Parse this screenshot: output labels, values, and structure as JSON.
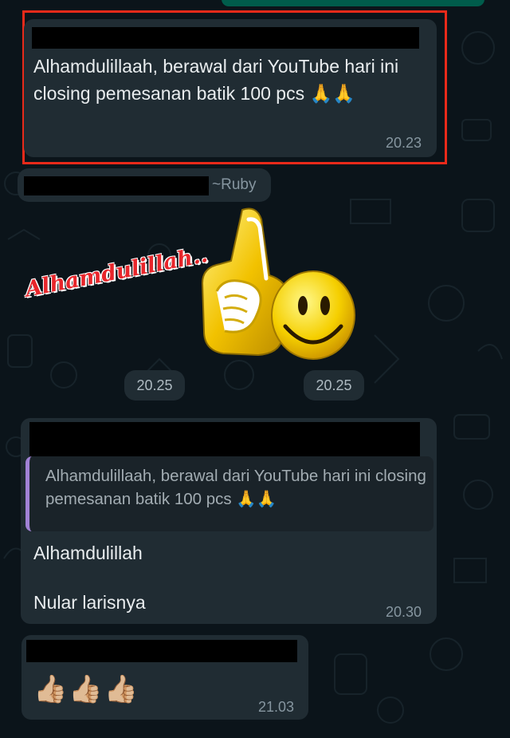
{
  "messages": [
    {
      "text": "Alhamdulillaah, berawal dari YouTube hari ini closing pemesanan batik 100 pcs 🙏🙏",
      "time": "20.23"
    }
  ],
  "sticker_sender": {
    "name": "~Ruby"
  },
  "stickers": [
    {
      "label": "Alhamdulillah..",
      "time": "20.25",
      "icon": "alhamdulillah-text-sticker"
    },
    {
      "time": "20.25",
      "icon": "thumbs-up-smiley-sticker"
    }
  ],
  "reply_message": {
    "quoted_text": "Alhamdulillaah, berawal dari YouTube hari ini closing pemesanan batik 100 pcs 🙏🙏",
    "line1": "Alhamdulillah",
    "line2": "Nular larisnya",
    "time": "20.30"
  },
  "last_message": {
    "emojis": "👍🏼👍🏼👍🏼",
    "time": "21.03"
  },
  "colors": {
    "background": "#0b141a",
    "bubble": "#202c33",
    "outgoing_bubble": "#005c4b",
    "highlight_border": "#ea2a1a",
    "quote_bar": "#a182d6"
  }
}
